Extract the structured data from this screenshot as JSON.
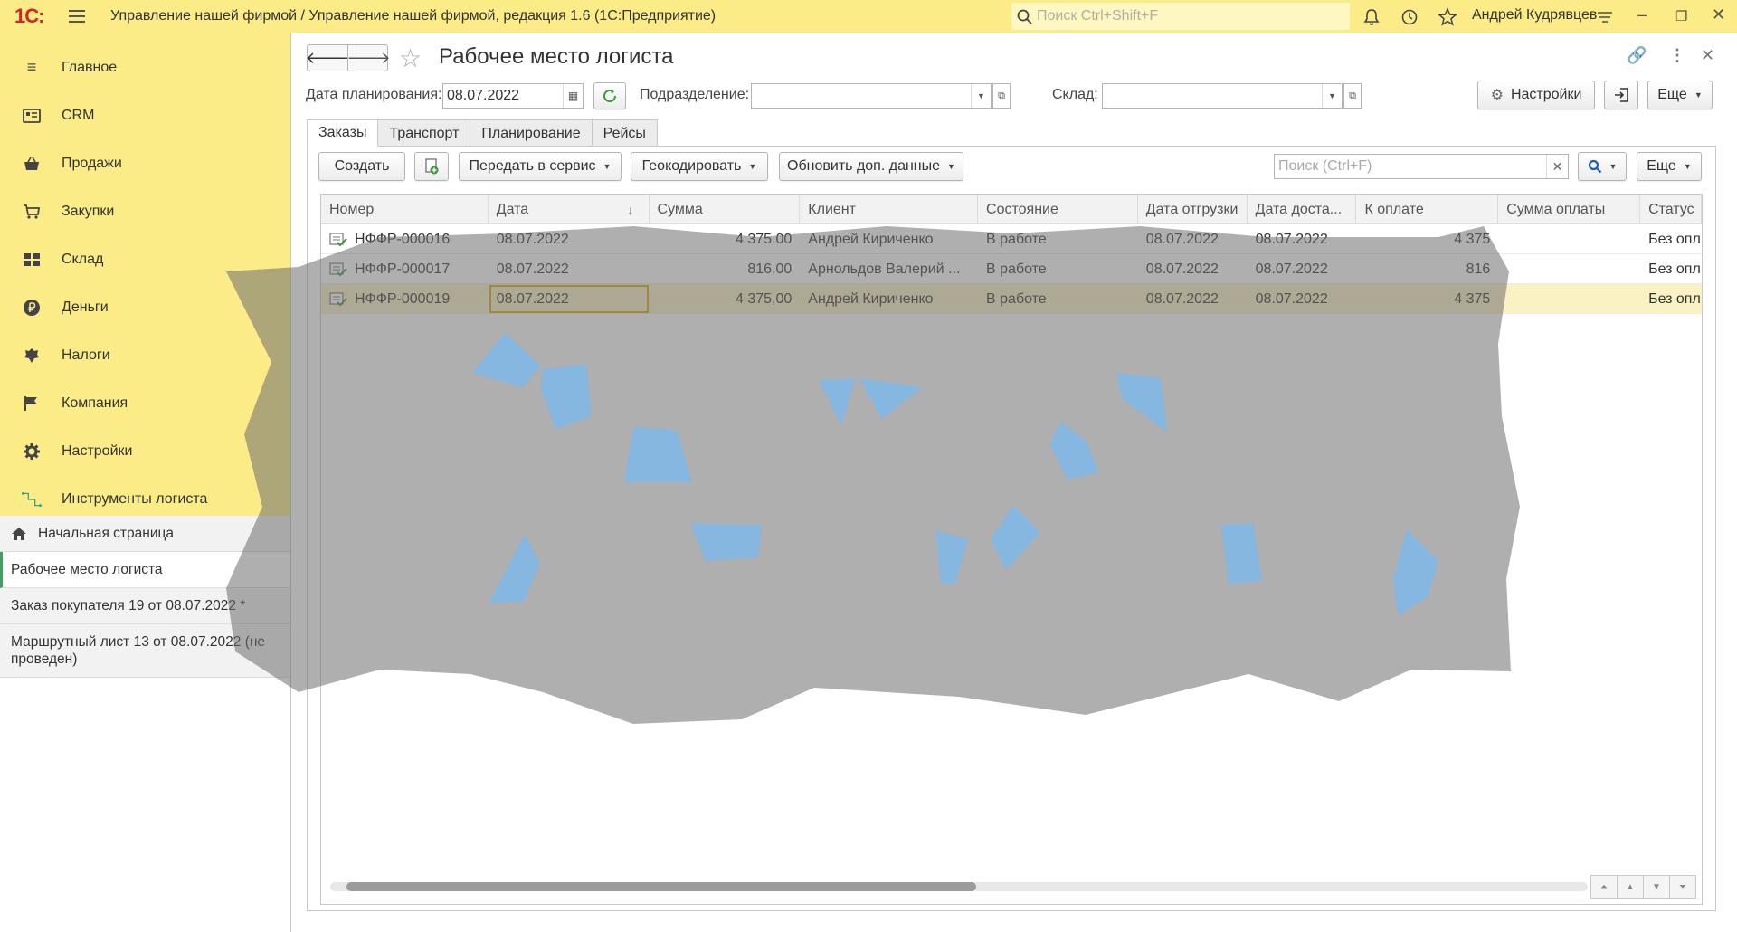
{
  "titlebar": {
    "logo": "1С:",
    "title": "Управление нашей фирмой / Управление нашей фирмой, редакция 1.6  (1С:Предприятие)",
    "search_placeholder": "Поиск Ctrl+Shift+F",
    "user": "Андрей Кудрявцев"
  },
  "sidebar": {
    "sections": [
      {
        "label": "Главное",
        "icon": "menu-lines-icon"
      },
      {
        "label": "CRM",
        "icon": "crm-icon"
      },
      {
        "label": "Продажи",
        "icon": "basket-icon"
      },
      {
        "label": "Закупки",
        "icon": "cart-icon"
      },
      {
        "label": "Склад",
        "icon": "warehouse-icon"
      },
      {
        "label": "Деньги",
        "icon": "ruble-icon"
      },
      {
        "label": "Налоги",
        "icon": "emblem-icon"
      },
      {
        "label": "Компания",
        "icon": "flag-icon"
      },
      {
        "label": "Настройки",
        "icon": "gear-icon"
      },
      {
        "label": "Инструменты логиста",
        "icon": "route-icon"
      }
    ],
    "open_windows": [
      {
        "label": "Начальная страница"
      },
      {
        "label": "Рабочее место логиста"
      },
      {
        "label": "Заказ покупателя 19 от 08.07.2022 *"
      },
      {
        "label": "Маршрутный лист 13 от 08.07.2022 (не проведен)"
      }
    ]
  },
  "form": {
    "title": "Рабочее место логиста",
    "date_label": "Дата планирования:",
    "date_value": "08.07.2022",
    "division_label": "Подразделение:",
    "division_value": "",
    "warehouse_label": "Склад:",
    "warehouse_value": "",
    "settings_button": "Настройки",
    "more_button": "Еще",
    "tabs": [
      "Заказы",
      "Транспорт",
      "Планирование",
      "Рейсы"
    ],
    "toolbar": {
      "create": "Создать",
      "send_to_service": "Передать в сервис",
      "geocode": "Геокодировать",
      "update_data": "Обновить доп. данные",
      "search_placeholder": "Поиск (Ctrl+F)",
      "more": "Еще"
    },
    "table": {
      "columns": [
        "Номер",
        "Дата",
        "Сумма",
        "Клиент",
        "Состояние",
        "Дата отгрузки",
        "Дата доста...",
        "К оплате",
        "Сумма оплаты",
        "Статус"
      ],
      "rows": [
        [
          "НФФР-000016",
          "08.07.2022",
          "4 375,00",
          "Андрей Кириченко",
          "В работе",
          "08.07.2022",
          "08.07.2022",
          "4 375",
          "",
          "Без опл"
        ],
        [
          "НФФР-000017",
          "08.07.2022",
          "816,00",
          "Арнольдов Валерий ...",
          "В работе",
          "08.07.2022",
          "08.07.2022",
          "816",
          "",
          "Без опл"
        ],
        [
          "НФФР-000019",
          "08.07.2022",
          "4 375,00",
          "Андрей Кириченко",
          "В работе",
          "08.07.2022",
          "08.07.2022",
          "4 375",
          "",
          "Без опл"
        ]
      ],
      "selected_row": 2
    }
  },
  "colors": {
    "accent_yellow": "#fbec88",
    "logo_red": "#d0262b",
    "active_green": "#40a060",
    "selection": "#fbf2c4"
  }
}
